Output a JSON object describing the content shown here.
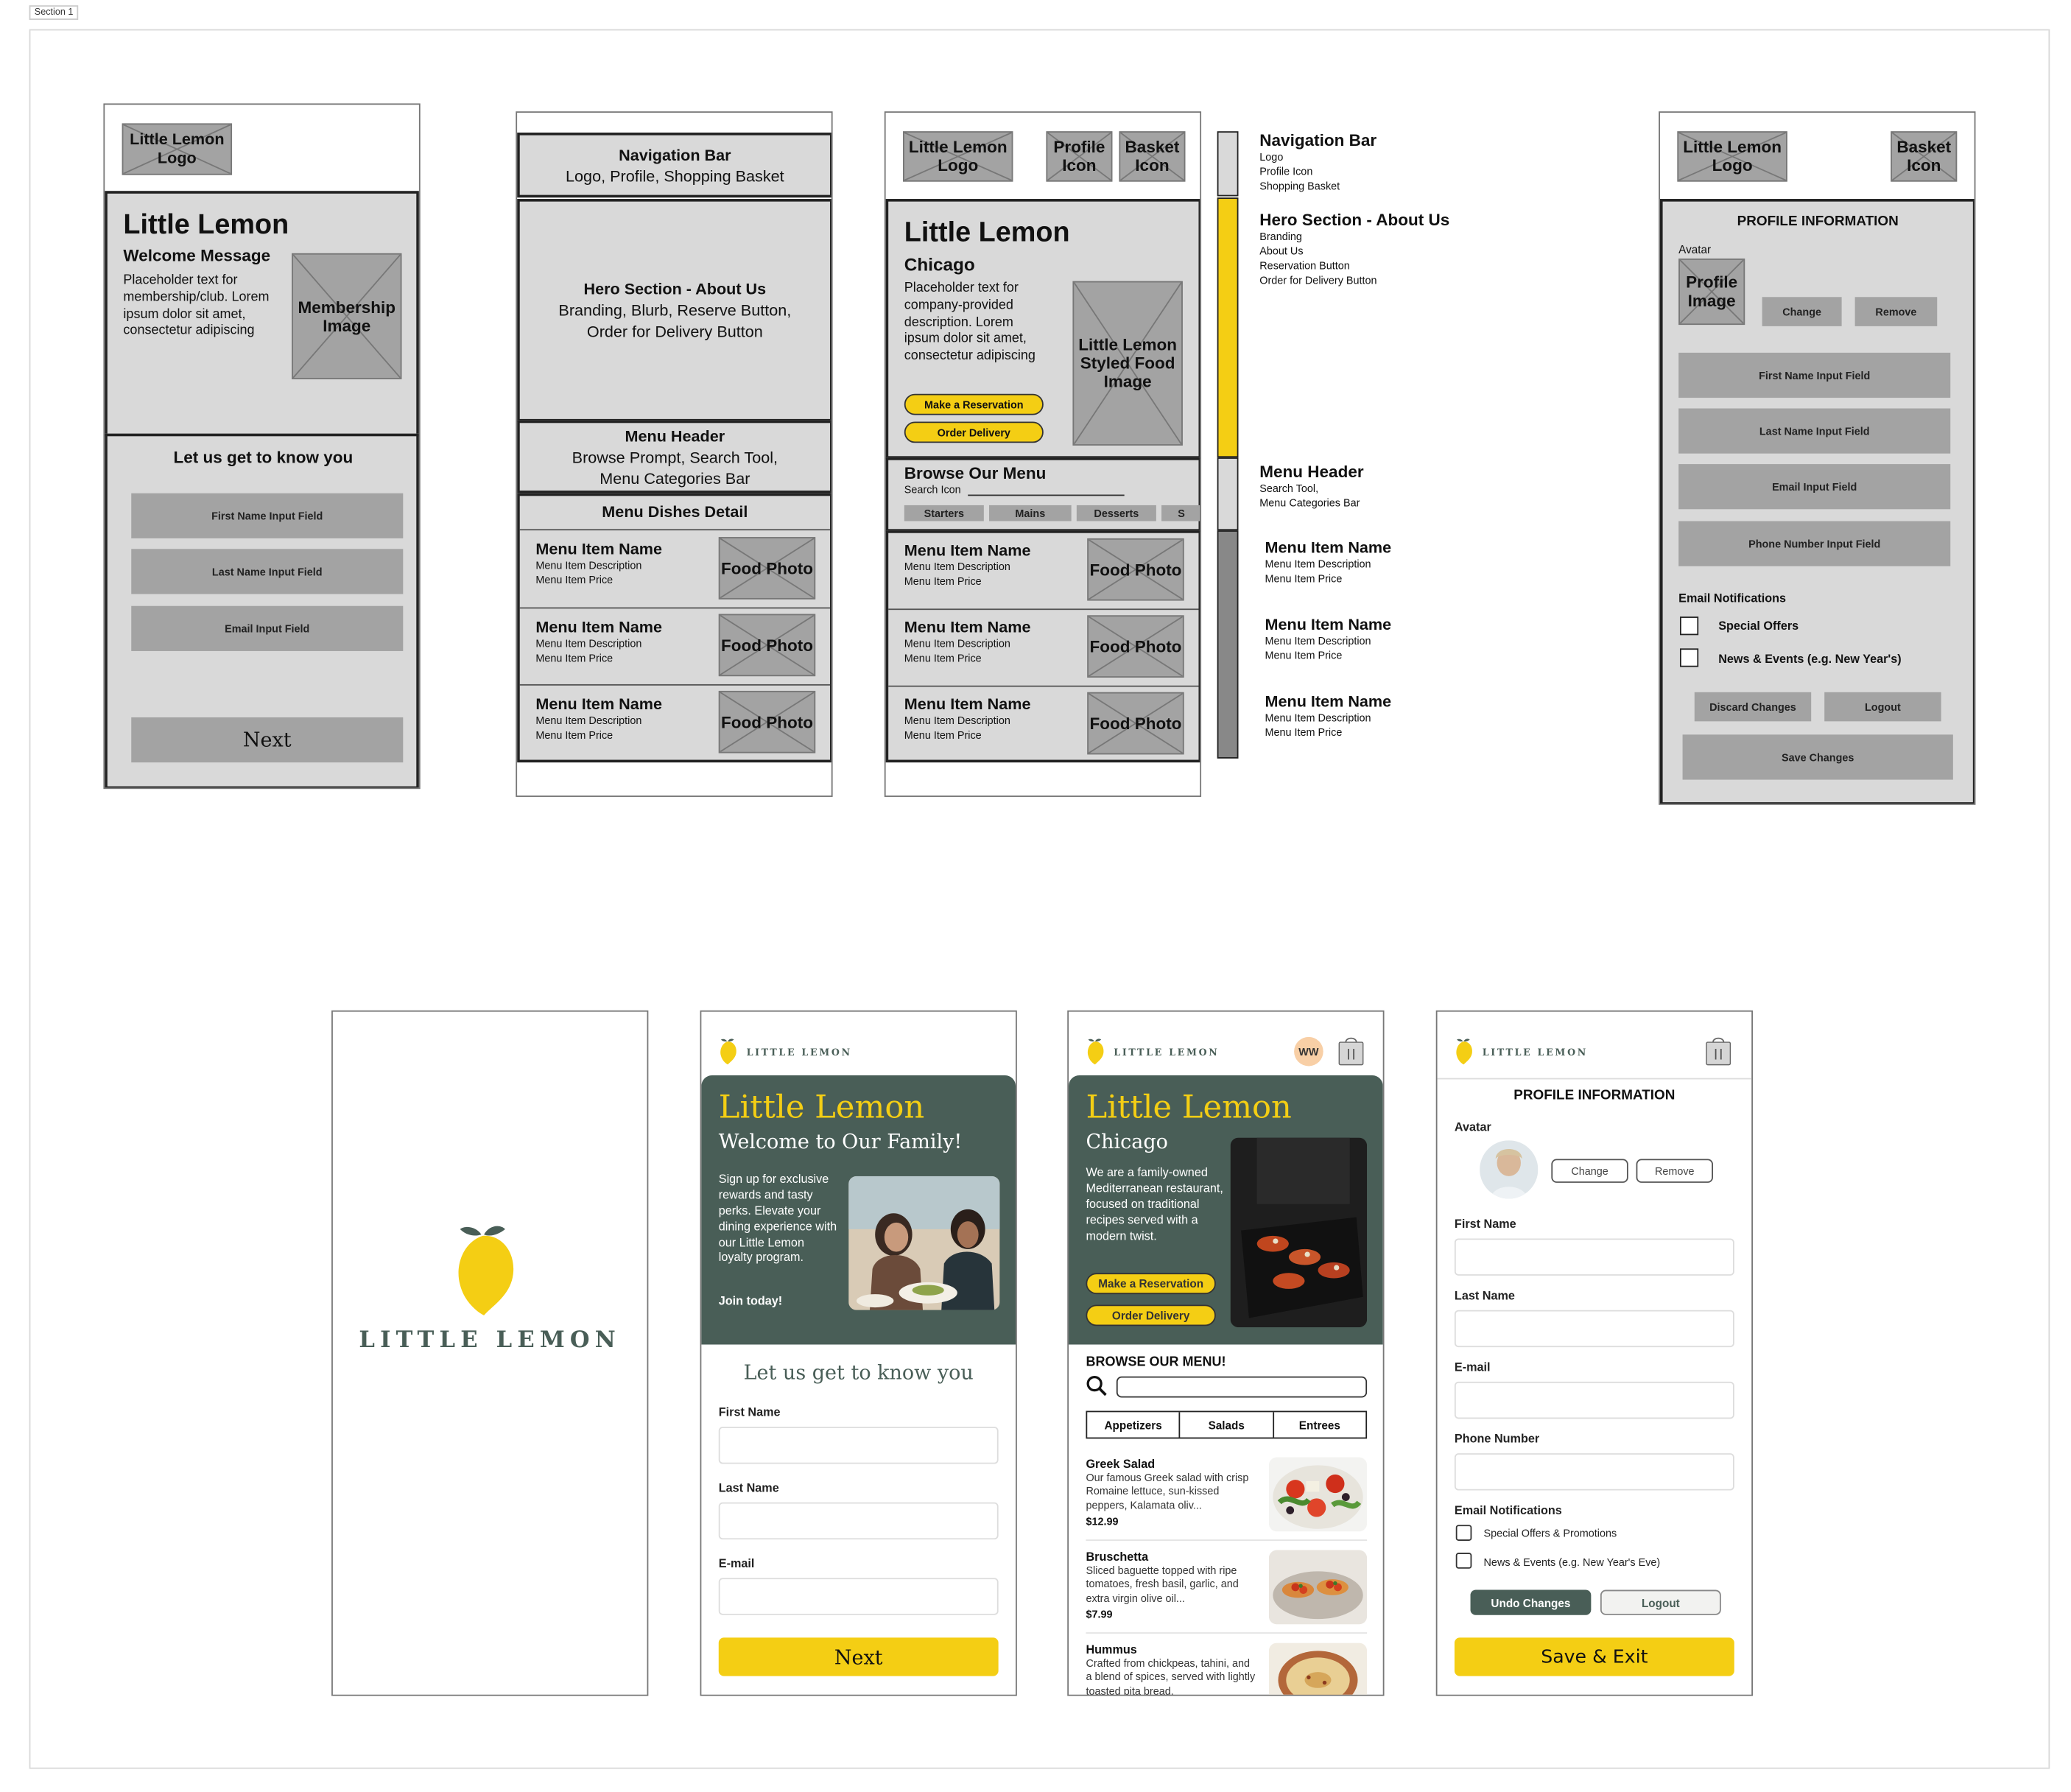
{
  "section_label": "Section 1",
  "colors": {
    "lemon_yellow": "#F4CE14",
    "lemon_green": "#495E57",
    "wire_grey": "#D9D9D9",
    "wire_placeholder": "#A3A3A3"
  },
  "wf_onboarding": {
    "logo": "Little Lemon Logo",
    "title": "Little Lemon",
    "subtitle": "Welcome Message",
    "body": "Placeholder text for membership/club. Lorem ipsum dolor sit amet, consectetur adipiscing",
    "image": "Membership Image",
    "form_heading": "Let us get to know you",
    "first_name": "First Name Input Field",
    "last_name": "Last Name Input Field",
    "email": "Email Input Field",
    "next": "Next"
  },
  "wf_structure": {
    "nav_title": "Navigation Bar",
    "nav_desc": "Logo, Profile, Shopping Basket",
    "hero_title": "Hero Section - About Us",
    "hero_desc_1": "Branding, Blurb, Reserve Button,",
    "hero_desc_2": "Order for Delivery Button",
    "menu_header_title": "Menu Header",
    "menu_header_desc_1": "Browse Prompt, Search Tool,",
    "menu_header_desc_2": "Menu Categories Bar",
    "dishes_title": "Menu Dishes Detail",
    "items": [
      {
        "name": "Menu Item Name",
        "desc": "Menu Item Description",
        "price": "Menu Item Price",
        "photo": "Food Photo"
      },
      {
        "name": "Menu Item Name",
        "desc": "Menu Item Description",
        "price": "Menu Item Price",
        "photo": "Food Photo"
      },
      {
        "name": "Menu Item Name",
        "desc": "Menu Item Description",
        "price": "Menu Item Price",
        "photo": "Food Photo"
      }
    ]
  },
  "wf_home": {
    "logo": "Little Lemon Logo",
    "profile_icon": "Profile Icon",
    "basket_icon": "Basket Icon",
    "title": "Little Lemon",
    "city": "Chicago",
    "body": "Placeholder text for company-provided description. Lorem ipsum dolor sit amet, consectetur adipiscing",
    "reserve": "Make a Reservation",
    "delivery": "Order Delivery",
    "image": "Little Lemon Styled Food Image",
    "browse": "Browse Our Menu",
    "search": "Search Icon",
    "categories": [
      "Starters",
      "Mains",
      "Desserts",
      "S"
    ],
    "items": [
      {
        "name": "Menu Item Name",
        "desc": "Menu Item Description",
        "price": "Menu Item Price",
        "photo": "Food Photo"
      },
      {
        "name": "Menu Item Name",
        "desc": "Menu Item Description",
        "price": "Menu Item Price",
        "photo": "Food Photo"
      },
      {
        "name": "Menu Item Name",
        "desc": "Menu Item Description",
        "price": "Menu Item Price",
        "photo": "Food Photo"
      }
    ]
  },
  "annotations": {
    "nav_title": "Navigation Bar",
    "nav_lines": [
      "Logo",
      "Profile Icon",
      "Shopping Basket"
    ],
    "hero_title": "Hero Section - About Us",
    "hero_lines": [
      "Branding",
      "About Us",
      "Reservation Button",
      "Order for Delivery Button"
    ],
    "menu_title": "Menu Header",
    "menu_lines": [
      "Search Tool,",
      "Menu Categories Bar"
    ],
    "items": [
      {
        "name": "Menu Item Name",
        "desc": "Menu Item Description",
        "price": "Menu Item Price"
      },
      {
        "name": "Menu Item Name",
        "desc": "Menu Item Description",
        "price": "Menu Item Price"
      },
      {
        "name": "Menu Item Name",
        "desc": "Menu Item Description",
        "price": "Menu Item Price"
      }
    ]
  },
  "wf_profile": {
    "logo": "Little Lemon Logo",
    "basket_icon": "Basket Icon",
    "title": "PROFILE INFORMATION",
    "avatar_label": "Avatar",
    "profile_image": "Profile Image",
    "change": "Change",
    "remove": "Remove",
    "first_name": "First Name Input Field",
    "last_name": "Last Name Input Field",
    "email": "Email Input Field",
    "phone": "Phone Number Input Field",
    "notifications": "Email Notifications",
    "opt1": "Special Offers",
    "opt2": "News & Events (e.g. New Year's)",
    "discard": "Discard Changes",
    "logout": "Logout",
    "save": "Save Changes"
  },
  "hf_splash": {
    "brand": "LITTLE LEMON"
  },
  "hf_onboarding": {
    "brand": "LITTLE LEMON",
    "title": "Little Lemon",
    "subtitle": "Welcome to Our Family!",
    "body": "Sign up for exclusive rewards and tasty perks. Elevate your dining experience with our Little Lemon loyalty program.",
    "join": "Join today!",
    "form_heading": "Let us get to know you",
    "first_name": "First Name",
    "last_name": "Last Name",
    "email": "E-mail",
    "next": "Next"
  },
  "hf_home": {
    "brand": "LITTLE LEMON",
    "avatar_initials": "WW",
    "title": "Little Lemon",
    "city": "Chicago",
    "body": "We are a family-owned Mediterranean restaurant, focused on traditional recipes served with a modern twist.",
    "reserve": "Make a Reservation",
    "delivery": "Order Delivery",
    "browse": "BROWSE OUR MENU!",
    "categories": [
      "Appetizers",
      "Salads",
      "Entrees"
    ],
    "dishes": [
      {
        "name": "Greek Salad",
        "desc": "Our famous Greek salad with crisp Romaine lettuce, sun-kissed peppers, Kalamata oliv...",
        "price": "$12.99"
      },
      {
        "name": "Bruschetta",
        "desc": "Sliced baguette topped with ripe tomatoes, fresh basil, garlic, and extra virgin olive oil...",
        "price": "$7.99"
      },
      {
        "name": "Hummus",
        "desc": "Crafted from chickpeas, tahini, and a blend of spices, served with lightly toasted pita bread.",
        "price": ""
      }
    ]
  },
  "hf_profile": {
    "brand": "LITTLE LEMON",
    "title": "PROFILE INFORMATION",
    "avatar_label": "Avatar",
    "change": "Change",
    "remove": "Remove",
    "first_name": "First Name",
    "last_name": "Last Name",
    "email": "E-mail",
    "phone": "Phone Number",
    "notifications": "Email Notifications",
    "opt1": "Special Offers & Promotions",
    "opt2": "News & Events (e.g. New Year's Eve)",
    "undo": "Undo Changes",
    "logout": "Logout",
    "save": "Save & Exit"
  }
}
